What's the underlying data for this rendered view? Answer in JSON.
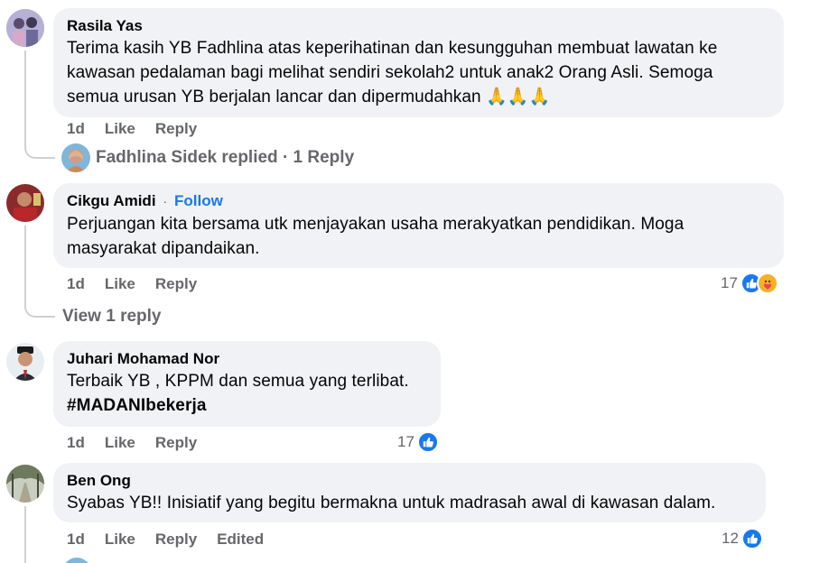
{
  "comments": [
    {
      "author": "Rasila Yas",
      "text_lines": [
        "Terima kasih YB Fadhlina atas keperihatinan dan kesungguhan membuat lawatan ke",
        "kawasan pedalaman bagi melihat sendiri sekolah2 untuk anak2 Orang Asli. Semoga",
        "semua urusan YB berjalan lancar dan dipermudahkan 🙏🙏🙏"
      ],
      "time": "1d",
      "like_label": "Like",
      "reply_label": "Reply",
      "replies": {
        "text": "Fadhlina Sidek replied · 1 Reply"
      }
    },
    {
      "author": "Cikgu Amidi",
      "follow_label": "Follow",
      "separator": "·",
      "text_lines": [
        "Perjuangan kita bersama utk menjayakan usaha merakyatkan pendidikan. Moga",
        "masyarakat dipandaikan."
      ],
      "time": "1d",
      "like_label": "Like",
      "reply_label": "Reply",
      "reaction_count": "17",
      "reaction_icons": [
        "like-icon",
        "care-icon"
      ],
      "replies": {
        "text": "View 1 reply"
      }
    },
    {
      "author": "Juhari Mohamad Nor",
      "text_lines": [
        "Terbaik YB , KPPM dan semua yang terlibat.",
        "#MADANIbekerja"
      ],
      "time": "1d",
      "like_label": "Like",
      "reply_label": "Reply",
      "reaction_count": "17",
      "reaction_icons": [
        "like-icon"
      ]
    },
    {
      "author": "Ben Ong",
      "text_lines": [
        "Syabas YB!! Inisiatif yang begitu bermakna untuk madrasah awal di kawasan dalam."
      ],
      "time": "1d",
      "like_label": "Like",
      "reply_label": "Reply",
      "edited_label": "Edited",
      "reaction_count": "12",
      "reaction_icons": [
        "like-icon"
      ]
    }
  ],
  "colors": {
    "bubble": "#f0f2f5",
    "meta": "#65676b",
    "link": "#1877f2",
    "like": "#1877f2",
    "care": "#f7b125"
  }
}
